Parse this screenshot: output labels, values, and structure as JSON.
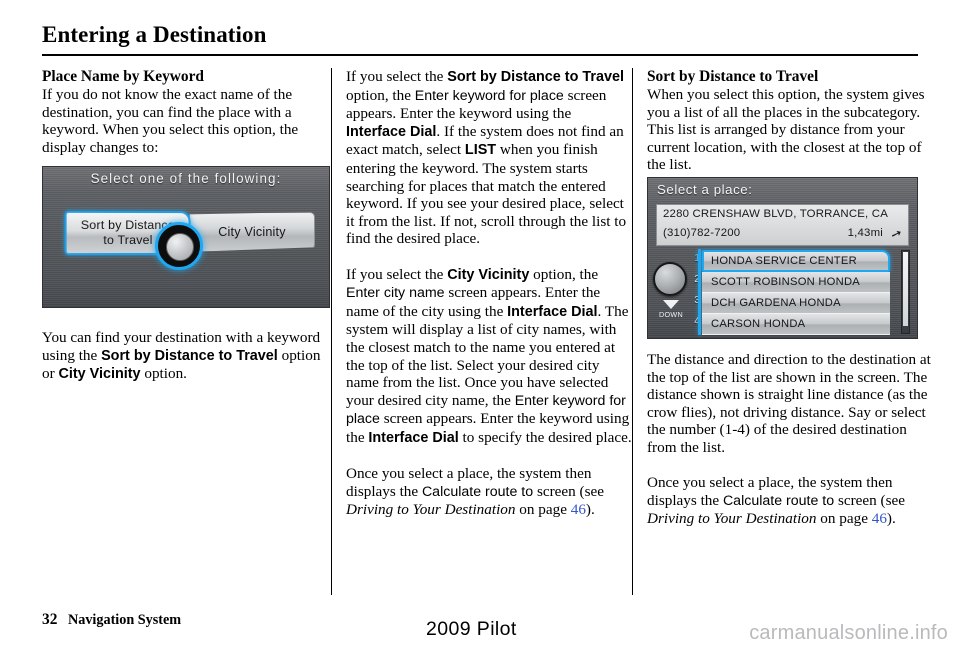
{
  "header": {
    "title": "Entering a Destination"
  },
  "columns": {
    "left": {
      "heading": "Place Name by Keyword",
      "intro": "If you do not know the exact name of the destination, you can find the place with a keyword. When you select this option, the display changes to:",
      "after_figure": {
        "p1_a": "You can find your destination with a keyword using the ",
        "p1_b": "Sort by Distance to Travel",
        "p1_c": " option or ",
        "p1_d": "City Vicinity",
        "p1_e": " option."
      }
    },
    "middle": {
      "p1_a": "If you select the ",
      "p1_b": "Sort by Distance to Travel",
      "p1_c": " option, the ",
      "p1_d": "Enter keyword for place",
      "p1_e": " screen appears. Enter the keyword using the ",
      "p1_f": "Interface Dial",
      "p1_g": ". If the system does not find an exact match, select ",
      "p1_h": "LIST",
      "p1_i": " when you finish entering the keyword. The system starts searching for places that match the entered keyword. If you see your desired place, select it from the list. If not, scroll through the list to find the desired place.",
      "p2_a": "If you select the ",
      "p2_b": "City Vicinity",
      "p2_c": " option, the ",
      "p2_d": "Enter city name",
      "p2_e": " screen appears. Enter the name of the city using the ",
      "p2_f": "Interface Dial",
      "p2_g": ". The system will display a list of city names, with the closest match to the name you entered at the top of the list. Select your desired city name from the list. Once you have selected your desired city name, the ",
      "p2_h": "Enter keyword for place",
      "p2_i": " screen appears. Enter the keyword using the ",
      "p2_j": "Interface Dial",
      "p2_k": " to specify the desired place.",
      "p3_a": "Once you select a place, the system then displays the ",
      "p3_b": "Calculate route to",
      "p3_c": " screen (see ",
      "p3_d": "Driving to Your Destination",
      "p3_e": " on page ",
      "p3_page": "46",
      "p3_f": ")."
    },
    "right": {
      "heading": "Sort by Distance to Travel",
      "intro": "When you select this option, the system gives you a list of all the places in the subcategory. This list is arranged by distance from your current location, with the closest at the top of the list.",
      "p2": "The distance and direction to the destination at the top of the list are shown in the screen. The distance shown is straight line distance (as the crow flies), not driving distance. Say or select the number (1-4) of the desired destination from the list.",
      "p3_a": "Once you select a place, the system then displays the ",
      "p3_b": "Calculate route to",
      "p3_c": " screen (see ",
      "p3_d": "Driving to Your Destination",
      "p3_e": " on page ",
      "p3_page": "46",
      "p3_f": ")."
    }
  },
  "screen_a": {
    "header": "Select one of the following:",
    "button_left_line1": "Sort by Distance",
    "button_left_line2": "to Travel",
    "button_right": "City Vicinity",
    "accent_color": "#1fa7f0"
  },
  "screen_b": {
    "header": "Select a place:",
    "address": "2280 CRENSHAW BLVD, TORRANCE, CA",
    "phone": "(310)782-7200",
    "distance": "1,43mi",
    "direction_icon": "direction-arrow-icon",
    "items": [
      {
        "number": "1",
        "label": "HONDA SERVICE CENTER",
        "selected": true
      },
      {
        "number": "2",
        "label": "SCOTT ROBINSON HONDA",
        "selected": false
      },
      {
        "number": "3",
        "label": "DCH GARDENA HONDA",
        "selected": false
      },
      {
        "number": "4",
        "label": "CARSON HONDA",
        "selected": false
      }
    ],
    "down_label": "DOWN",
    "accent_color": "#1fa7f0"
  },
  "footer": {
    "page_number": "32",
    "section": "Navigation System",
    "model": "2009  Pilot",
    "watermark": "carmanualsonline.info"
  }
}
